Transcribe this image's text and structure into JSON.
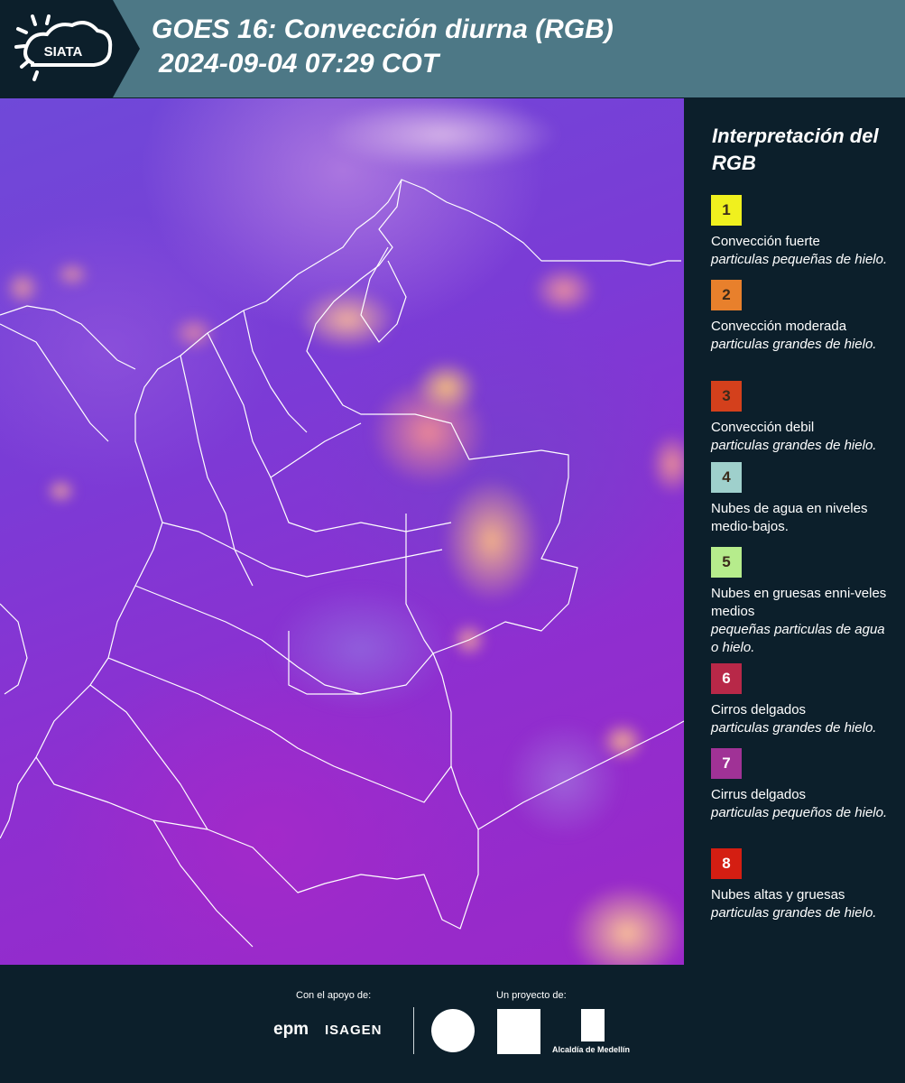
{
  "header": {
    "logo_text": "SIATA",
    "title": "GOES 16: Convección diurna (RGB)",
    "subtitle": "2024-09-04 07:29 COT"
  },
  "legend": {
    "title": "Interpretación del RGB",
    "items": [
      {
        "number": "1",
        "color": "#f0f01e",
        "label": "Convección fuerte",
        "desc": "particulas pequeñas de hielo."
      },
      {
        "number": "2",
        "color": "#e8802c",
        "label": "Convección moderada",
        "desc": "particulas grandes de hielo."
      },
      {
        "number": "3",
        "color": "#d4401c",
        "label": "Convección debil",
        "desc": "particulas grandes de hielo."
      },
      {
        "number": "4",
        "color": "#9fd0cc",
        "label": "Nubes de agua en niveles medio-bajos.",
        "desc": ""
      },
      {
        "number": "5",
        "color": "#b6ec8c",
        "label": "Nubes en gruesas enni-veles medios",
        "desc": "pequeñas particulas de agua o hielo."
      },
      {
        "number": "6",
        "color": "#b82848",
        "label": "Cirros delgados",
        "desc": "particulas grandes de hielo."
      },
      {
        "number": "7",
        "color": "#a03296",
        "label": "Cirrus delgados",
        "desc": "particulas pequeños de hielo."
      },
      {
        "number": "8",
        "color": "#d41e12",
        "label": "Nubes altas y gruesas",
        "desc": "particulas grandes de hielo."
      }
    ]
  },
  "footer": {
    "support_label": "Con el apoyo de:",
    "project_label": "Un proyecto de:",
    "sponsors": [
      "epm",
      "ISAGEN"
    ],
    "partners": [
      "Alcaldía de Medellín"
    ]
  }
}
